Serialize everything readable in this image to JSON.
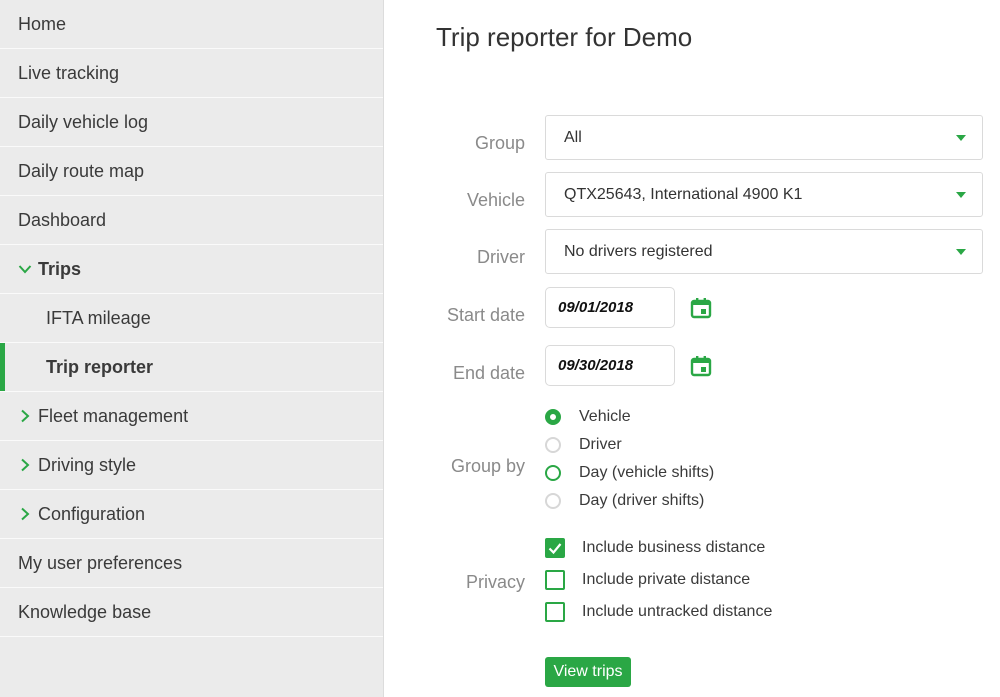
{
  "sidebar": {
    "items": [
      {
        "label": "Home"
      },
      {
        "label": "Live tracking"
      },
      {
        "label": "Daily vehicle log"
      },
      {
        "label": "Daily route map"
      },
      {
        "label": "Dashboard"
      },
      {
        "label": "Trips"
      },
      {
        "label": "IFTA mileage"
      },
      {
        "label": "Trip reporter"
      },
      {
        "label": "Fleet management"
      },
      {
        "label": "Driving style"
      },
      {
        "label": "Configuration"
      },
      {
        "label": "My user preferences"
      },
      {
        "label": "Knowledge base"
      }
    ]
  },
  "main": {
    "title": "Trip reporter for Demo",
    "group": {
      "label": "Group",
      "value": "All"
    },
    "vehicle": {
      "label": "Vehicle",
      "value": "QTX25643, International 4900 K1"
    },
    "driver": {
      "label": "Driver",
      "value": "No drivers registered"
    },
    "start_date": {
      "label": "Start date",
      "value": "09/01/2018"
    },
    "end_date": {
      "label": "End date",
      "value": "09/30/2018"
    },
    "group_by": {
      "label": "Group by",
      "options": [
        "Vehicle",
        "Driver",
        "Day (vehicle shifts)",
        "Day (driver shifts)"
      ],
      "selected": "Vehicle"
    },
    "privacy": {
      "label": "Privacy",
      "options": [
        {
          "label": "Include business distance",
          "checked": true
        },
        {
          "label": "Include private distance",
          "checked": false
        },
        {
          "label": "Include untracked distance",
          "checked": false
        }
      ]
    },
    "view_button": "View trips"
  },
  "colors": {
    "accent": "#2aa745",
    "sidebar_bg": "#ebebeb",
    "label_text": "#8a8a8a"
  },
  "icons": {
    "calendar": "calendar-icon",
    "chevron_down": "chevron-down-icon",
    "chevron_right": "chevron-right-icon",
    "dropdown": "dropdown-caret-icon",
    "check": "check-icon"
  }
}
